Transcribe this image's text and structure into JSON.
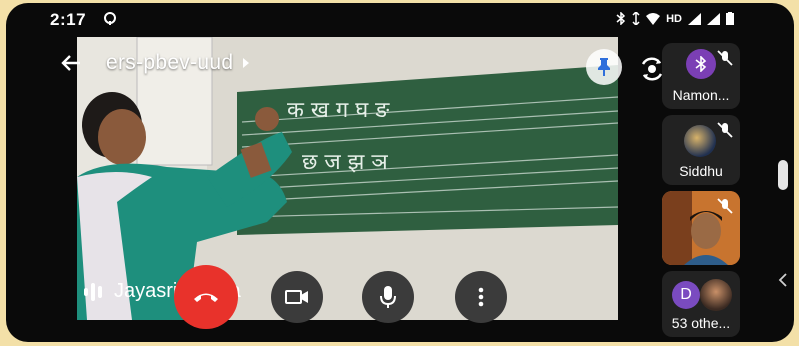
{
  "status": {
    "time": "2:17",
    "network_label": "HD"
  },
  "meeting": {
    "code": "ers-pbev-uud",
    "speaker_name": "Jayasri Rekha"
  },
  "participants": [
    {
      "name": "Namon...",
      "avatar_letter": "",
      "avatar_color": "#7b3fb5",
      "muted": true
    },
    {
      "name": "Siddhu",
      "avatar_letter": "",
      "avatar_color": "#3a3a3a",
      "muted": true
    },
    {
      "name": "",
      "avatar_letter": "",
      "avatar_color": "#c46a2e",
      "muted": true
    },
    {
      "name": "53 othe...",
      "avatar_letter": "D",
      "avatar_color": "#7a4bc0",
      "muted": false
    }
  ],
  "board": {
    "row1": "क ख ग घ ङ",
    "row2": "छ ज झ ञ"
  },
  "colors": {
    "hangup": "#e8322b",
    "control_bg": "#3b3b3b",
    "board": "#2d5a3d",
    "backdrop": "#f3e0a8"
  },
  "icons": {
    "back": "arrow-left-icon",
    "pin": "pin-icon",
    "switch_camera": "switch-camera-icon",
    "hangup": "phone-hangup-icon",
    "camera": "videocam-icon",
    "mic": "mic-icon",
    "more": "more-vert-icon"
  }
}
